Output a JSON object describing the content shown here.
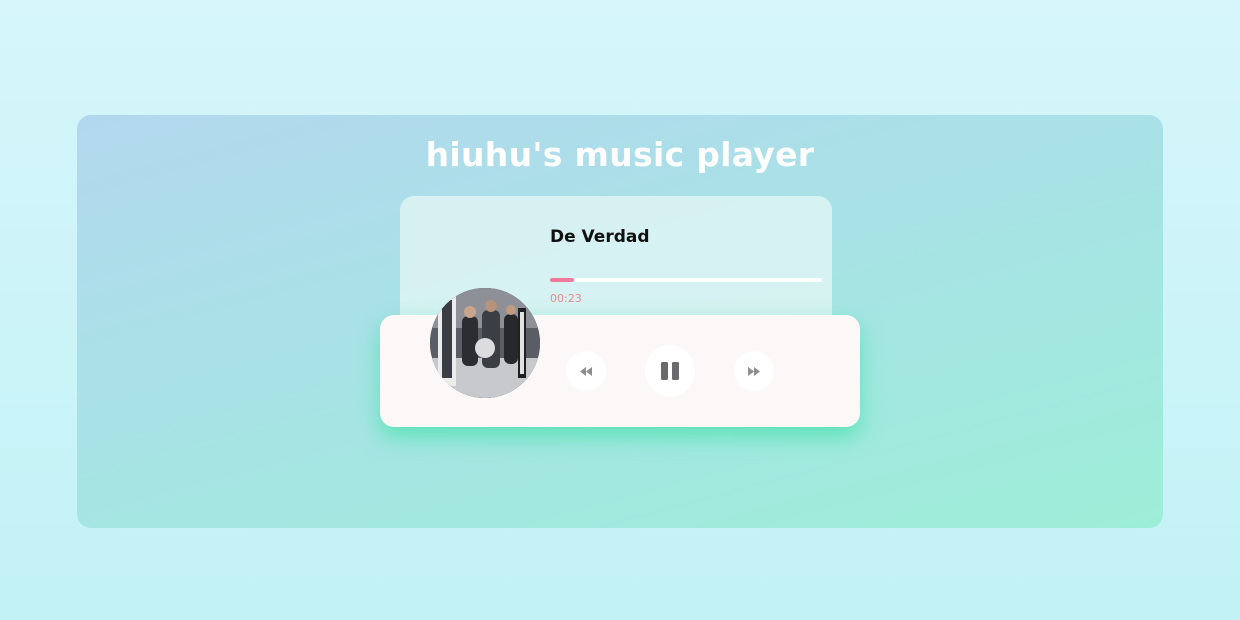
{
  "app": {
    "title": "hiuhu's music player"
  },
  "track": {
    "title": "De Verdad",
    "current_time": "00:23",
    "progress_fraction": 0.09,
    "is_playing": true
  },
  "controls": {
    "prev_icon": "rewind-icon",
    "play_pause_icon": "pause-icon",
    "next_icon": "fast-forward-icon"
  },
  "colors": {
    "progress_fill": "#f47a9c",
    "time_text": "#e98a8a",
    "glow": "#46e2aa"
  }
}
